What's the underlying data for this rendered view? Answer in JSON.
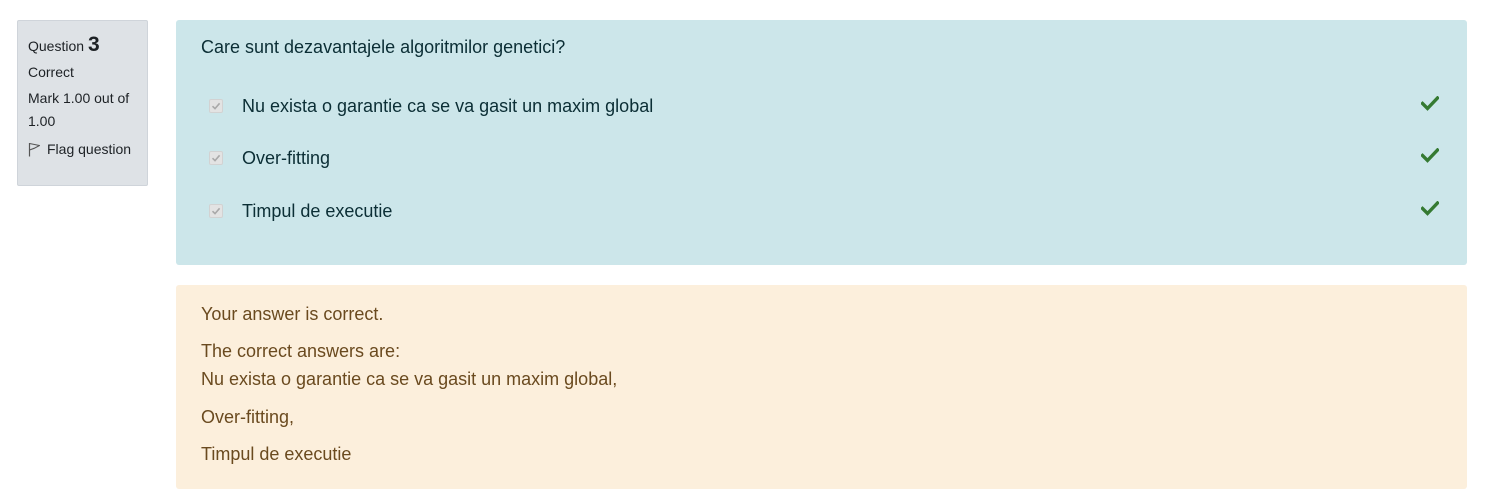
{
  "info": {
    "question_label": "Question",
    "question_number": "3",
    "state": "Correct",
    "grade": "Mark 1.00 out of 1.00",
    "flag_label": "Flag question"
  },
  "question": {
    "text": "Care sunt dezavantajele algoritmilor genetici?",
    "answers": [
      {
        "label": "Nu exista o garantie ca se va gasit un maxim global",
        "checked": true,
        "correct": true
      },
      {
        "label": "Over-fitting",
        "checked": true,
        "correct": true
      },
      {
        "label": "Timpul de executie",
        "checked": true,
        "correct": true
      }
    ]
  },
  "feedback": {
    "summary": "Your answer is correct.",
    "correct_heading": "The correct answers are:",
    "correct_answers": [
      "Nu exista o garantie ca se va gasit un maxim global,",
      "Over-fitting,",
      "Timpul de executie"
    ]
  },
  "colors": {
    "question_bg": "#cce6ea",
    "feedback_bg": "#fcefdc",
    "info_bg": "#dee2e6",
    "correct_tick": "#357a32"
  }
}
